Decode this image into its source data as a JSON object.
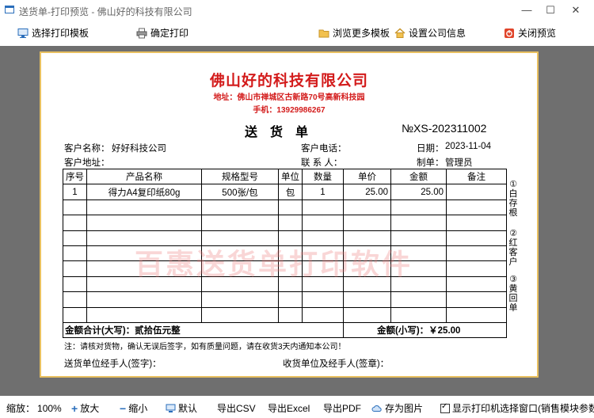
{
  "window": {
    "title": "送货单-打印预览 - 佛山好的科技有限公司",
    "minimize": "—",
    "maximize": "☐",
    "close": "✕"
  },
  "toolbar": {
    "select_template": "选择打印模板",
    "confirm_print": "确定打印",
    "browse_templates": "浏览更多模板",
    "company_settings": "设置公司信息",
    "close_preview": "关闭预览"
  },
  "document": {
    "company": "佛山好的科技有限公司",
    "address": "地址：佛山市禅城区古新路70号高新科技园",
    "phone": "手机：13929986267",
    "title": "送 货 单",
    "number": "№XS-202311002",
    "customer_name_label": "客户名称：",
    "customer_name": "好好科技公司",
    "customer_phone_label": "客户电话：",
    "date_label": "日期：",
    "date": "2023-11-04",
    "customer_address_label": "客户地址：",
    "contact_label": "联 系 人：",
    "maker_label": "制单：",
    "maker": "管理员",
    "columns": [
      "序号",
      "产品名称",
      "规格型号",
      "单位",
      "数量",
      "单价",
      "金额",
      "备注"
    ],
    "rows": [
      [
        "1",
        "得力A4复印纸80g",
        "500张/包",
        "包",
        "1",
        "25.00",
        "25.00",
        ""
      ]
    ],
    "total_upper": "金额合计(大写)：贰拾伍元整",
    "total_lower": "金额(小写)：￥25.00",
    "side_notes": [
      "①白存根",
      "②红客户",
      "③黄回单"
    ],
    "watermark": "百惠送货单打印软件",
    "footnote": "注：请核对货物，确认无误后签字，如有质量问题，请在收货3天内通知本公司！",
    "sign_sender": "送货单位经手人(签字)：",
    "sign_receiver": "收货单位及经手人(签章)："
  },
  "statusbar": {
    "zoom_label": "缩放：",
    "zoom_value": "100%",
    "zoom_in": "放大",
    "zoom_out": "缩小",
    "default": "默认",
    "export_csv": "导出CSV",
    "export_excel": "导出Excel",
    "export_pdf": "导出PDF",
    "save_image": "存为图片",
    "show_printer_dialog": "显示打印机选择窗口(销售模块参数)"
  },
  "colors": {
    "accent_red": "#d31b1b",
    "paper_border": "#e8c060",
    "preview_bg": "#6f6f6f"
  }
}
